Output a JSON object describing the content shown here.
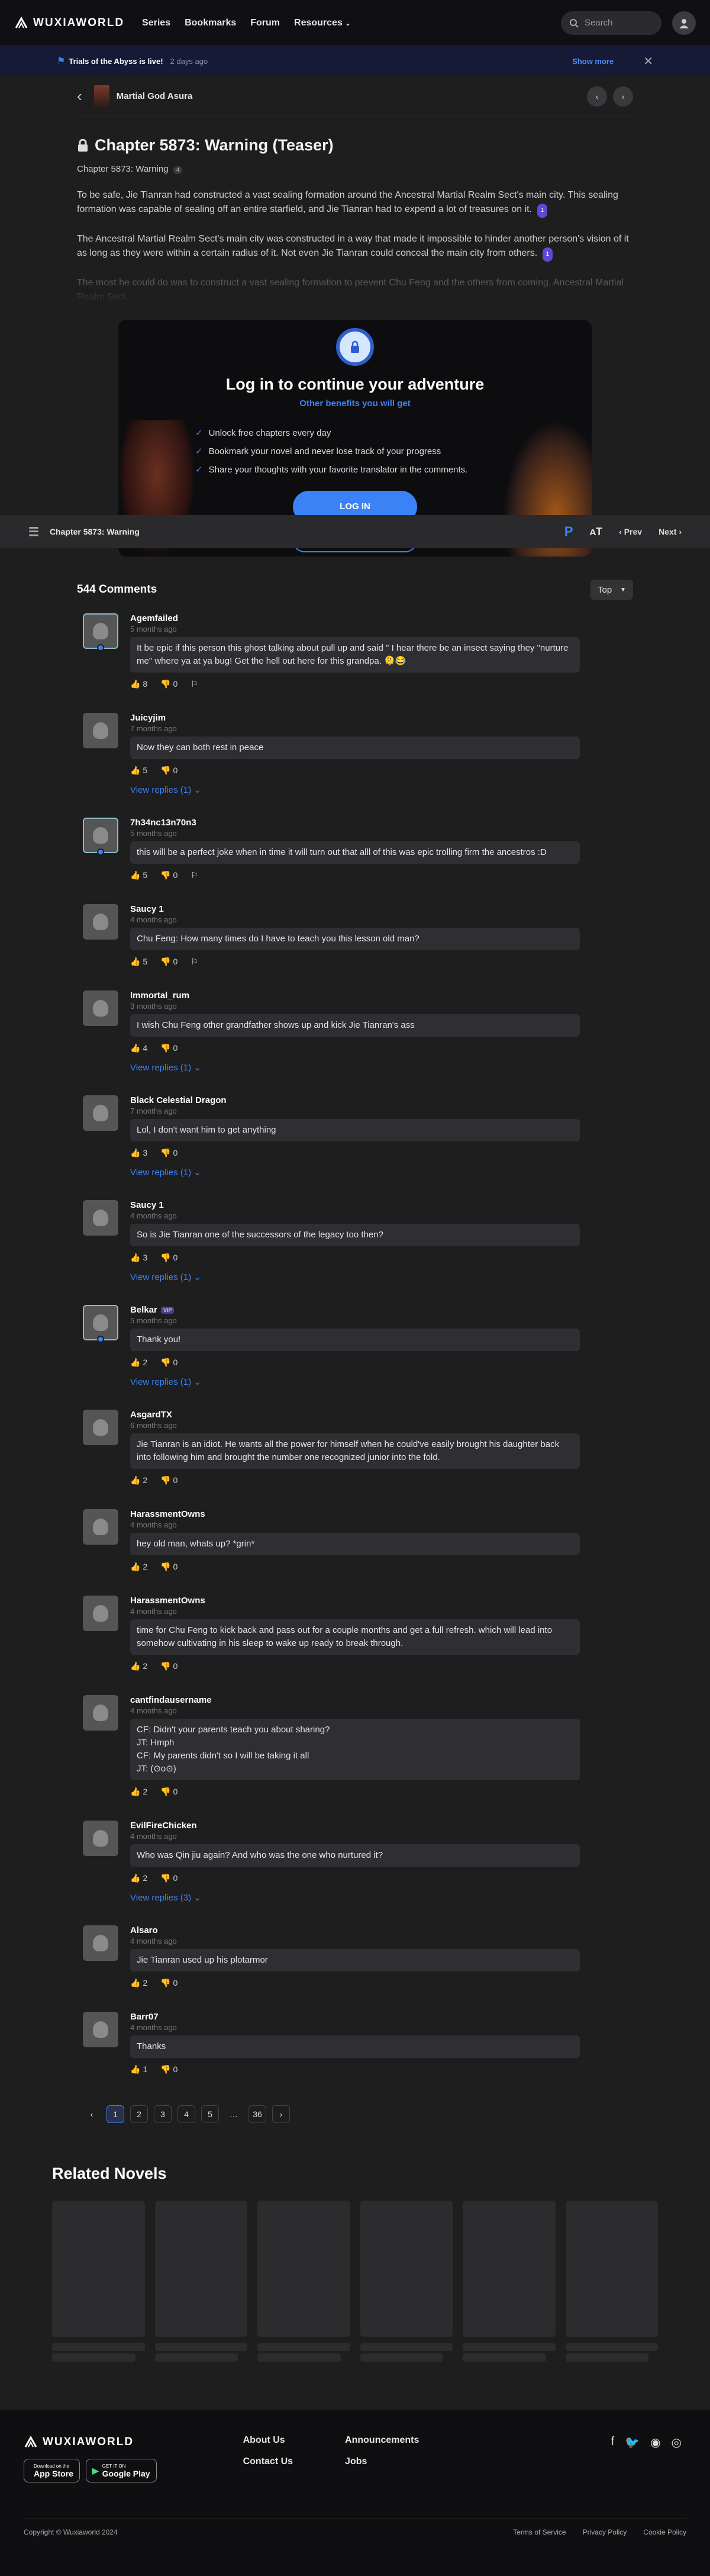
{
  "brand": {
    "name": "WUXIAWORLD"
  },
  "nav": [
    "Series",
    "Bookmarks",
    "Forum",
    "Resources"
  ],
  "search": {
    "placeholder": "Search"
  },
  "banner": {
    "title": "Trials of the Abyss is live!",
    "ago": "2 days ago",
    "more": "Show more"
  },
  "novel": {
    "title": "Martial God Asura"
  },
  "chapter": {
    "title": "Chapter 5873: Warning (Teaser)",
    "subtitle": "Chapter 5873: Warning",
    "subtitle_badge": "4",
    "paragraphs": [
      {
        "text": "To be safe, Jie Tianran had constructed a vast sealing formation around the Ancestral Martial Realm Sect's main city. This sealing formation was capable of sealing off an entire starfield, and Jie Tianran had to expend a lot of treasures on it.",
        "badge": "1"
      },
      {
        "text": "The Ancestral Martial Realm Sect's main city was constructed in a way that made it impossible to hinder another person's vision of it as long as they were within a certain radius of it. Not even Jie Tianran could conceal the main city from others.",
        "badge": "1"
      }
    ],
    "faded": "The most he could do was to construct a vast sealing formation to prevent Chu Feng and the others from coming, Ancestral Martial Realm Sect."
  },
  "login": {
    "title": "Log in to continue your adventure",
    "benefits_title": "Other benefits you will get",
    "benefits": [
      "Unlock free chapters every day",
      "Bookmark your novel and never lose track of your progress",
      "Share your thoughts with your favorite translator in the comments."
    ],
    "login_label": "LOG IN",
    "signup_label": "SIGN UP"
  },
  "chapterbar": {
    "title": "Chapter 5873: Warning",
    "prev": "Prev",
    "next": "Next",
    "p": "P"
  },
  "comments": {
    "count": "544 Comments",
    "sort": "Top",
    "items": [
      {
        "user": "Agemfailed",
        "time": "5 months ago",
        "text": "It be epic if this person this ghost talking about pull up and said \" I hear there be an insect saying they \"nurture me\" where ya at ya bug! Get the hell out here for this grandpa. 🫠😂",
        "likes": "8",
        "dislikes": "0",
        "replies": ""
      },
      {
        "user": "Juicyjim",
        "time": "7 months ago",
        "text": "Now they can both rest in peace",
        "likes": "5",
        "dislikes": "0",
        "replies": "View replies (1)"
      },
      {
        "user": "7h34nc13n70n3",
        "time": "5 months ago",
        "text": "this will be a perfect joke when in time it will turn out that alll of this was epic trolling firm the ancestros :D",
        "likes": "5",
        "dislikes": "0",
        "replies": ""
      },
      {
        "user": "Saucy 1",
        "time": "4 months ago",
        "text": "Chu Feng: How many times do I have to teach you this lesson old man?",
        "likes": "5",
        "dislikes": "0",
        "replies": ""
      },
      {
        "user": "Immortal_rum",
        "time": "3 months ago",
        "text": "I wish Chu Feng other grandfather shows up and kick Jie Tianran's ass",
        "likes": "4",
        "dislikes": "0",
        "replies": "View replies (1)"
      },
      {
        "user": "Black Celestial Dragon",
        "time": "7 months ago",
        "text": "Lol, I don't want him to get anything",
        "likes": "3",
        "dislikes": "0",
        "replies": "View replies (1)"
      },
      {
        "user": "Saucy 1",
        "time": "4 months ago",
        "text": "So is Jie Tianran one of the successors of the legacy too then?",
        "likes": "3",
        "dislikes": "0",
        "replies": "View replies (1)"
      },
      {
        "user": "Belkar",
        "time": "5 months ago",
        "text": "Thank you!",
        "likes": "2",
        "dislikes": "0",
        "replies": "View replies (1)",
        "vip": "VIP"
      },
      {
        "user": "AsgardTX",
        "time": "6 months ago",
        "text": "Jie Tianran is an idiot. He wants all the power for himself when he could've easily brought his daughter back into following him and brought the number one recognized junior into the fold.",
        "likes": "2",
        "dislikes": "0",
        "replies": ""
      },
      {
        "user": "HarassmentOwns",
        "time": "4 months ago",
        "text": "hey old man, whats up? *grin*",
        "likes": "2",
        "dislikes": "0",
        "replies": ""
      },
      {
        "user": "HarassmentOwns",
        "time": "4 months ago",
        "text": "time for Chu Feng to kick back and pass out for a couple months and get a full refresh. which will lead into somehow cultivating in his sleep to wake up ready to break through.",
        "likes": "2",
        "dislikes": "0",
        "replies": ""
      },
      {
        "user": "cantfindausername",
        "time": "4 months ago",
        "text": "CF: Didn't your parents teach you about sharing?\nJT: Hmph\nCF: My parents didn't so I will be taking it all\nJT: (⊙o⊙)",
        "likes": "2",
        "dislikes": "0",
        "replies": ""
      },
      {
        "user": "EvilFireChicken",
        "time": "4 months ago",
        "text": "Who was Qin jiu again? And who was the one who nurtured it?",
        "likes": "2",
        "dislikes": "0",
        "replies": "View replies (3)"
      },
      {
        "user": "Alsaro",
        "time": "4 months ago",
        "text": "Jie Tianran used up his plotarmor",
        "likes": "2",
        "dislikes": "0",
        "replies": ""
      },
      {
        "user": "Barr07",
        "time": "4 months ago",
        "text": "Thanks",
        "likes": "1",
        "dislikes": "0",
        "replies": ""
      }
    ]
  },
  "pagination": [
    "1",
    "2",
    "3",
    "4",
    "5",
    "…",
    "36"
  ],
  "related": {
    "title": "Related Novels"
  },
  "footer": {
    "col1": [
      "About Us",
      "Contact Us"
    ],
    "col2": [
      "Announcements",
      "Jobs"
    ],
    "appstore": {
      "small": "Download on the",
      "big": "App Store"
    },
    "googleplay": {
      "small": "GET IT ON",
      "big": "Google Play"
    },
    "copyright": "Copyright © Wuxiaworld 2024",
    "legal": [
      "Terms of Service",
      "Privacy Policy",
      "Cookie Policy"
    ]
  }
}
